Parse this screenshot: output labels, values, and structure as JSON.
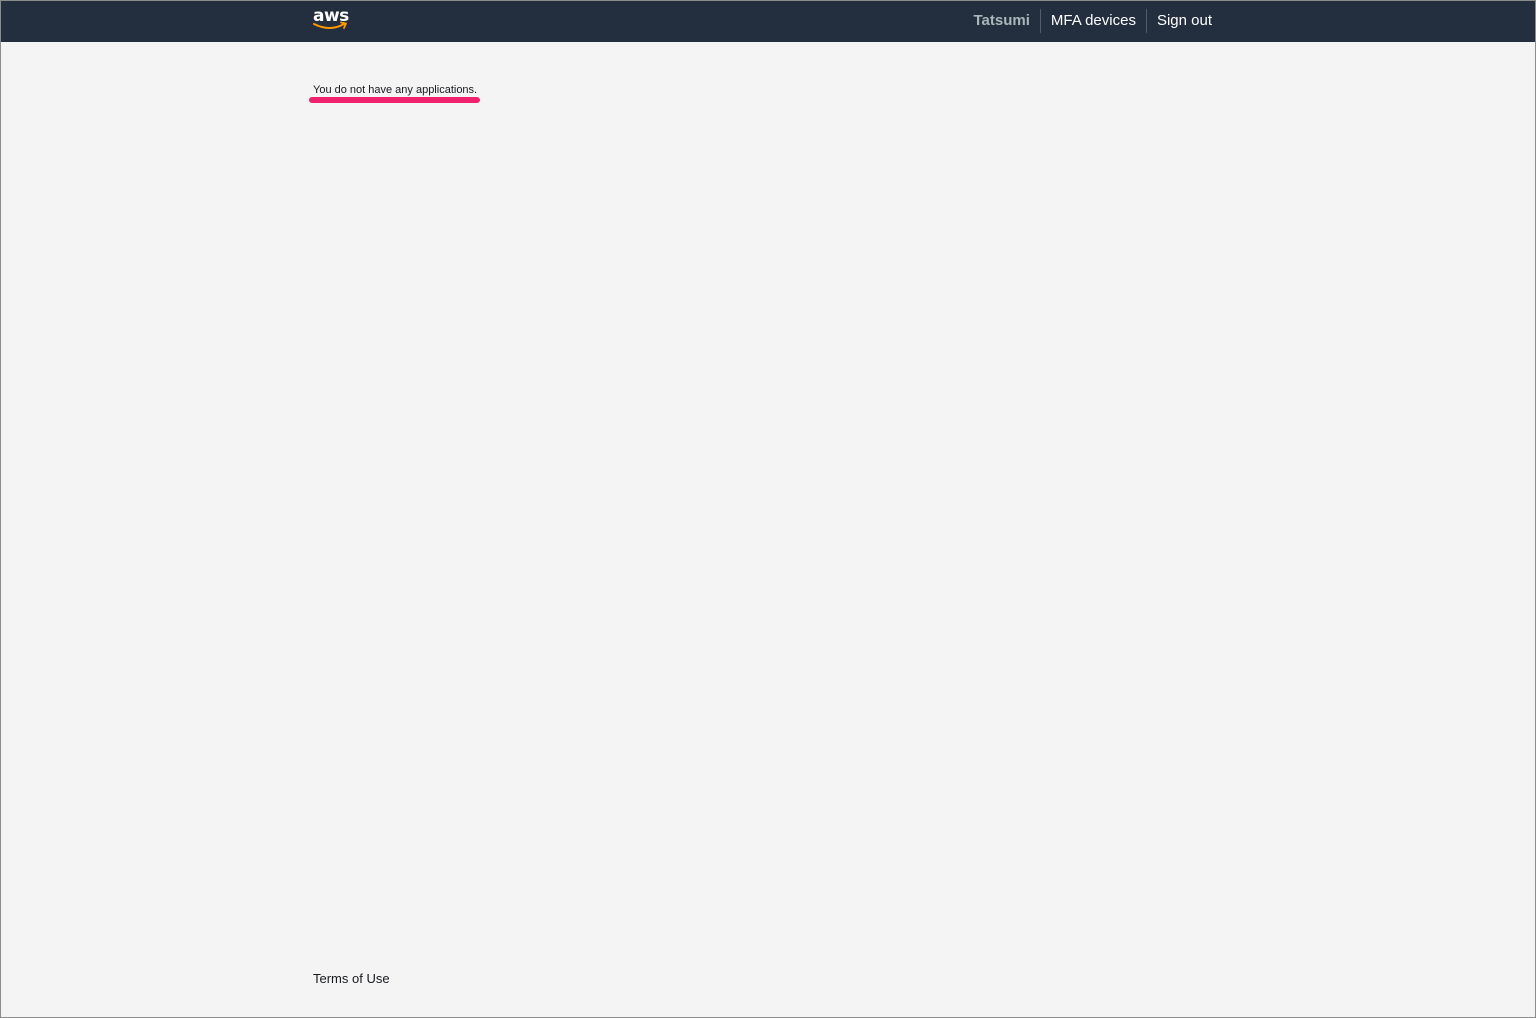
{
  "header": {
    "logo_text": "aws",
    "user_name": "Tatsumi",
    "mfa_label": "MFA devices",
    "signout_label": "Sign out"
  },
  "main": {
    "empty_message": "You do not have any applications."
  },
  "footer": {
    "terms_label": "Terms of Use"
  },
  "colors": {
    "header_bg": "#232f3e",
    "page_bg": "#f4f4f4",
    "logo_smile": "#ff9900",
    "highlight": "#f0216e"
  }
}
